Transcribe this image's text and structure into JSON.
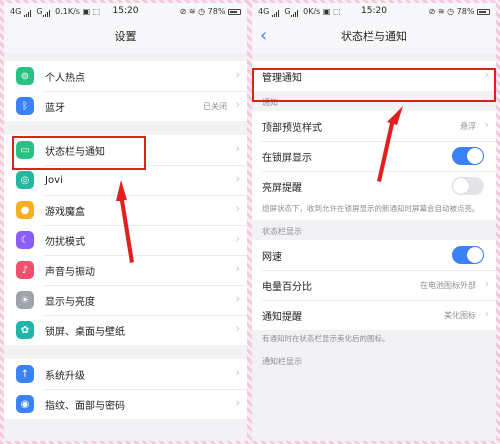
{
  "left": {
    "status": {
      "network": "4G",
      "speed": "0.1K/s",
      "time": "15:20",
      "battery": "78%"
    },
    "title": "设置",
    "groups": [
      [
        {
          "label": "个人热点",
          "icon": "hotspot-icon",
          "color": "#27c281",
          "glyph": "⊚"
        },
        {
          "label": "蓝牙",
          "icon": "bluetooth-icon",
          "color": "#3b82f6",
          "glyph": "ᛒ",
          "value": "已关闭"
        }
      ],
      [
        {
          "label": "状态栏与通知",
          "icon": "status-bar-icon",
          "color": "#27c281",
          "glyph": "▭"
        },
        {
          "label": "Jovi",
          "icon": "jovi-icon",
          "color": "#22b8a0",
          "glyph": "◎"
        },
        {
          "label": "游戏魔盒",
          "icon": "game-box-icon",
          "color": "#f5b021",
          "glyph": "●"
        },
        {
          "label": "勿扰模式",
          "icon": "do-not-disturb-icon",
          "color": "#8b5cf6",
          "glyph": "☾"
        },
        {
          "label": "声音与振动",
          "icon": "sound-icon",
          "color": "#f0506e",
          "glyph": "♪"
        },
        {
          "label": "显示与亮度",
          "icon": "brightness-icon",
          "color": "#a0a3ab",
          "glyph": "☀"
        },
        {
          "label": "锁屏、桌面与壁纸",
          "icon": "wallpaper-icon",
          "color": "#1fb5a8",
          "glyph": "✿"
        }
      ],
      [
        {
          "label": "系统升级",
          "icon": "system-upgrade-icon",
          "color": "#3b82f6",
          "glyph": "↑"
        },
        {
          "label": "指纹、面部与密码",
          "icon": "fingerprint-icon",
          "color": "#3b82f6",
          "glyph": "◉"
        }
      ]
    ]
  },
  "right": {
    "status": {
      "network": "4G",
      "speed": "0K/s",
      "time": "15:20",
      "battery": "78%"
    },
    "title": "状态栏与通知",
    "manage_notifications": "管理通知",
    "section_notification": "通知",
    "top_preview_label": "顶部预览样式",
    "top_preview_value": "悬浮",
    "lockscreen_label": "在锁屏显示",
    "lockscreen_on": true,
    "wake_label": "亮屏提醒",
    "wake_on": false,
    "wake_desc": "熄屏状态下，收到允许在锁屏显示的新通知时屏幕会自动被点亮。",
    "section_statusbar": "状态栏显示",
    "netspeed_label": "网速",
    "netspeed_on": true,
    "battery_label": "电量百分比",
    "battery_value": "在电池图标外部",
    "notify_label": "通知提醒",
    "notify_value": "美化图标",
    "notify_desc": "有通知时在状态栏显示美化后的图标。",
    "section_notifybar": "通知栏显示"
  },
  "colors": {
    "accent": "#3b82f6",
    "highlight": "#e21f1f"
  }
}
